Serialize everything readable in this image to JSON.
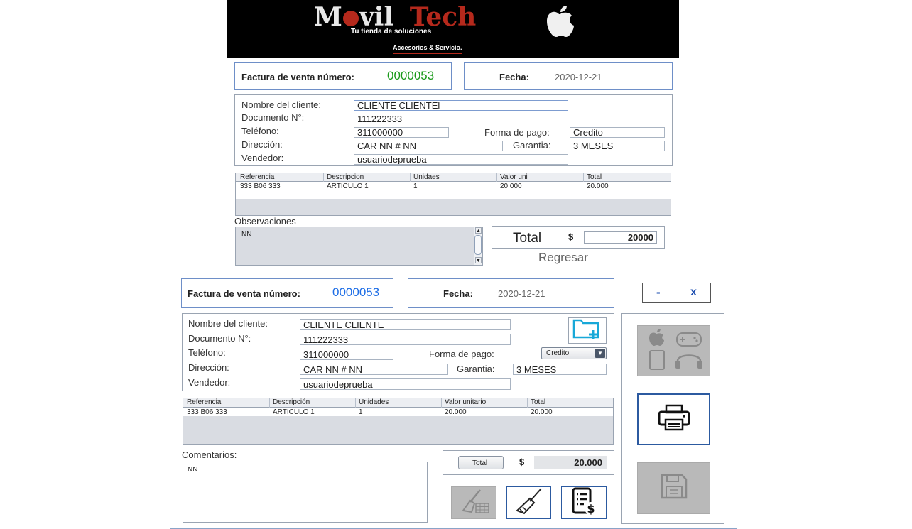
{
  "banner": {
    "brand_m": "M",
    "brand_rest1": "vil",
    "brand_rest2": "Tech",
    "tagline": "Tu tienda de soluciones",
    "subtitle": "Accesorios & Servicio."
  },
  "top": {
    "invoice_label": "Factura de venta número:",
    "invoice_number": "0000053",
    "date_label": "Fecha:",
    "date_value": "2020-12-21",
    "client_label": "Nombre del cliente:",
    "client_value": "CLIENTE CLIENTEl",
    "doc_label": "Documento N°:",
    "doc_value": "111222333",
    "phone_label": "Teléfono:",
    "phone_value": "311000000",
    "payment_label": "Forma de pago:",
    "payment_value": "Credito",
    "address_label": "Dirección:",
    "address_value": "CAR NN # NN",
    "warranty_label": "Garantia:",
    "warranty_value": "3 MESES",
    "seller_label": "Vendedor:",
    "seller_value": "usuariodeprueba",
    "table_headers": [
      "Referencia",
      "Descripcion",
      "Unidaes",
      "Valor uni",
      "Total"
    ],
    "table_row": [
      "333 B06 333",
      "ARTICULO 1",
      "1",
      "20.000",
      "20.000"
    ],
    "obs_label": "Observaciones",
    "obs_value": "NN",
    "total_label": "Total",
    "currency": "$",
    "total_value": "20000",
    "back_label": "Regresar"
  },
  "bottom": {
    "invoice_label": "Factura de venta número:",
    "invoice_number": "0000053",
    "date_label": "Fecha:",
    "date_value": "2020-12-21",
    "minimize": "-",
    "close": "x",
    "client_label": "Nombre del cliente:",
    "client_value": "CLIENTE CLIENTE",
    "doc_label": "Documento N°:",
    "doc_value": "111222333",
    "phone_label": "Teléfono:",
    "phone_value": "311000000",
    "payment_label": "Forma de pago:",
    "payment_value": "Credito",
    "address_label": "Dirección:",
    "address_value": "CAR NN # NN",
    "warranty_label": "Garantia:",
    "warranty_value": "3 MESES",
    "seller_label": "Vendedor:",
    "seller_value": "usuariodeprueba",
    "table_headers": [
      "Referencia",
      "Descripción",
      "Unidades",
      "Valor unitario",
      "Total"
    ],
    "table_row": [
      "333 B06 333",
      "ARTICULO 1",
      "1",
      "20.000",
      "20.000"
    ],
    "comments_label": "Comentarios:",
    "comments_value": "NN",
    "total_button": "Total",
    "currency": "$",
    "total_value": "20.000"
  },
  "colors": {
    "green_number": "#1a9a1a",
    "blue_number": "#1e6ee6",
    "banner_bg": "#000000",
    "tech_red": "#b5291c",
    "disabled_gray": "#b9b9b9",
    "accent_blue": "#2c5aa0"
  }
}
